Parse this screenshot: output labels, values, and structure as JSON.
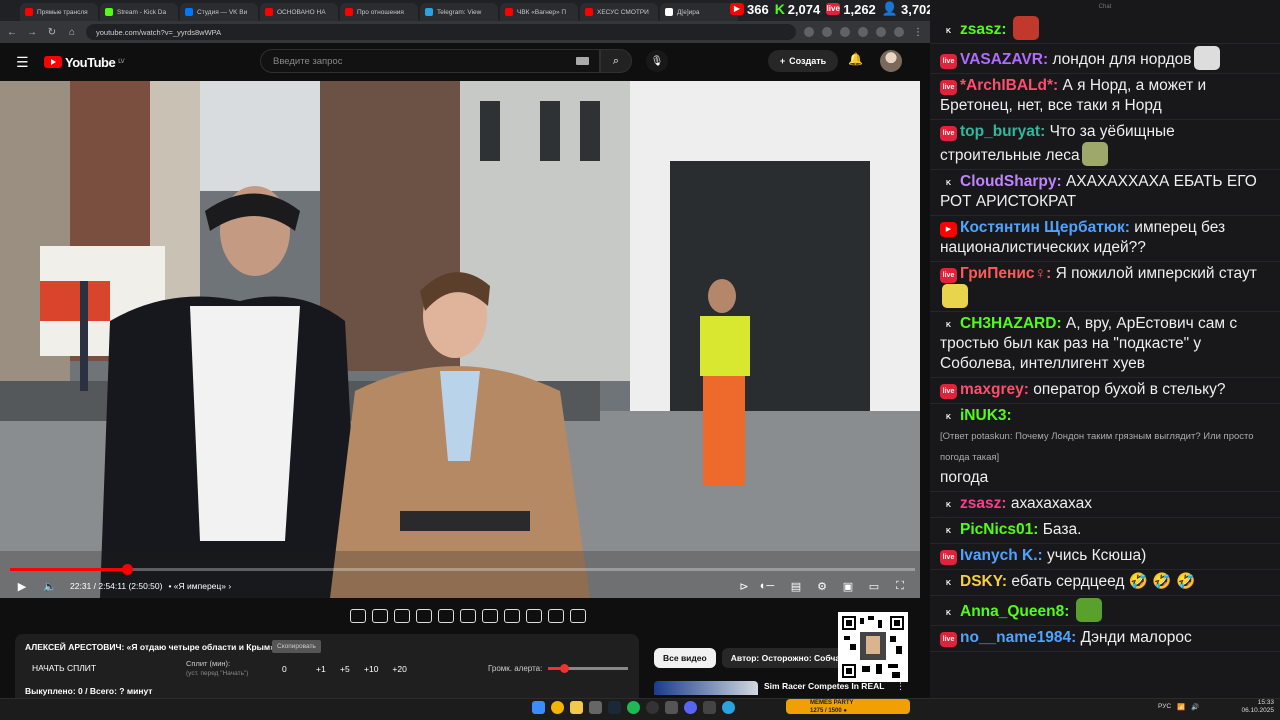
{
  "browser": {
    "tabs": [
      {
        "label": "Прямые трансля",
        "color": "#ff0000"
      },
      {
        "label": "Stream - Kick Da",
        "color": "#53fc18"
      },
      {
        "label": "Студия — VK Ви",
        "color": "#0077ff"
      },
      {
        "label": "ОСНОВАНО НА",
        "color": "#ff0000"
      },
      {
        "label": "Про отношения",
        "color": "#ff0000"
      },
      {
        "label": "Telegram: View",
        "color": "#2aa3de"
      },
      {
        "label": "ЧВК «Вагнер» П",
        "color": "#ff0000"
      },
      {
        "label": "ХЕСУС СМОТРИ",
        "color": "#ff0000"
      },
      {
        "label": "Д[e]ира",
        "color": "#ffffff"
      }
    ],
    "url": "youtube.com/watch?v=_yyrds8wWPA"
  },
  "stream_stats": {
    "youtube_viewers": "366",
    "kick_viewers": "2,074",
    "vk_viewers": "1,262",
    "total_viewers": "3,702",
    "colors": {
      "youtube": "#ff0000",
      "kick": "#53fc18",
      "vk": "#e0223a",
      "total": "#4f8fff"
    }
  },
  "youtube": {
    "logo_text": "YouTube",
    "region": "LV",
    "search_placeholder": "Введите запрос",
    "create_label": "Создать",
    "player": {
      "time": "22:31 / 2:54:11 (2:50:50)",
      "chapter": "• «Я имперец» ›",
      "progress": 0.129
    },
    "video_title": "АЛЕКСЕЙ АРЕСТОВИЧ: «Я отдаю четыре области и Крым»",
    "title_badge": "Скопировать",
    "split": {
      "button": "НАЧАТЬ СПЛИТ",
      "label": "Сплит (мин):",
      "hint": "(уст. перед \"Начать\")",
      "values": [
        "0",
        "+1",
        "+5",
        "+10",
        "+20"
      ],
      "alert_label": "Громк. алерта:",
      "alert_level": 0.2
    },
    "watched": "Выкуплено: 0 / Всего: ? минут",
    "chips": {
      "all": "Все видео",
      "author": "Автор: Осторожно: Собчак"
    },
    "recommendation_title": "Sim Racer Competes In REAL"
  },
  "chat": {
    "header": "Chat",
    "messages": [
      {
        "platform": "kick",
        "user": "zsasz:",
        "color": "#53fc18",
        "text": "",
        "emote": "#c0392b"
      },
      {
        "platform": "vk",
        "user": "VASAZAVR:",
        "color": "#b06bff",
        "text": "лондон для нордов",
        "emote": "#ddd"
      },
      {
        "platform": "vk",
        "user": "*ArchIBALd*:",
        "color": "#ff4d6d",
        "text": "А я Норд, а может и Бретонец, нет, все таки я Норд"
      },
      {
        "platform": "vk",
        "user": "top_buryat:",
        "color": "#2fb7a0",
        "text": "Что за уёбищные строительные леса",
        "emote": "#9ea86a"
      },
      {
        "platform": "kick",
        "user": "CloudSharpy:",
        "color": "#c084fc",
        "text": "АХАХАХХАХА ЕБАТЬ ЕГО РОТ АРИСТОКРАТ"
      },
      {
        "platform": "yt",
        "user": "Костянтин Щербатюк:",
        "color": "#4fa3ff",
        "text": "имперец без националистических идей??"
      },
      {
        "platform": "vk",
        "user": "ГриПенис♀:",
        "color": "#ff5a5a",
        "text": "Я пожилой имперский стаут",
        "emote": "#e8d44d"
      },
      {
        "platform": "kick",
        "user": "CH3HAZARD:",
        "color": "#53fc18",
        "text": "А, вру, АрЕстович сам с тростью был как раз на \"подкасте\" у Соболева, интеллигент хуев"
      },
      {
        "platform": "vk",
        "user": "maxgrey:",
        "color": "#ff4d6d",
        "text": "оператор бухой в стельку?"
      },
      {
        "platform": "kick",
        "user": "iNUK3:",
        "color": "#53fc18",
        "reply": "[Ответ potaskun: Почему Лондон таким грязным выглядит? Или просто погода такая]",
        "text": "погода"
      },
      {
        "platform": "kick",
        "user": "zsasz:",
        "color": "#ff3b8e",
        "text": "ахахахахах"
      },
      {
        "platform": "kick",
        "user": "PicNics01:",
        "color": "#53fc18",
        "text": "База."
      },
      {
        "platform": "vk",
        "user": "Ivanych K.:",
        "color": "#4fa3ff",
        "text": "учись Ксюша)"
      },
      {
        "platform": "kick",
        "user": "DSKY:",
        "color": "#f5d03b",
        "text": "ебать сердцеед 🤣 🤣 🤣"
      },
      {
        "platform": "kick",
        "user": "Anna_Queen8:",
        "color": "#53fc18",
        "text": "",
        "emote": "#5aa02c"
      },
      {
        "platform": "vk",
        "user": "no__name1984:",
        "color": "#4fa3ff",
        "text": "Дэнди малорос"
      }
    ]
  },
  "taskbar": {
    "gamebar_title": "MEMES PARTY",
    "gamebar_sub": "1275 / 1500 ●",
    "language": "РУС",
    "time": "15:33",
    "date": "06.10.2025"
  }
}
